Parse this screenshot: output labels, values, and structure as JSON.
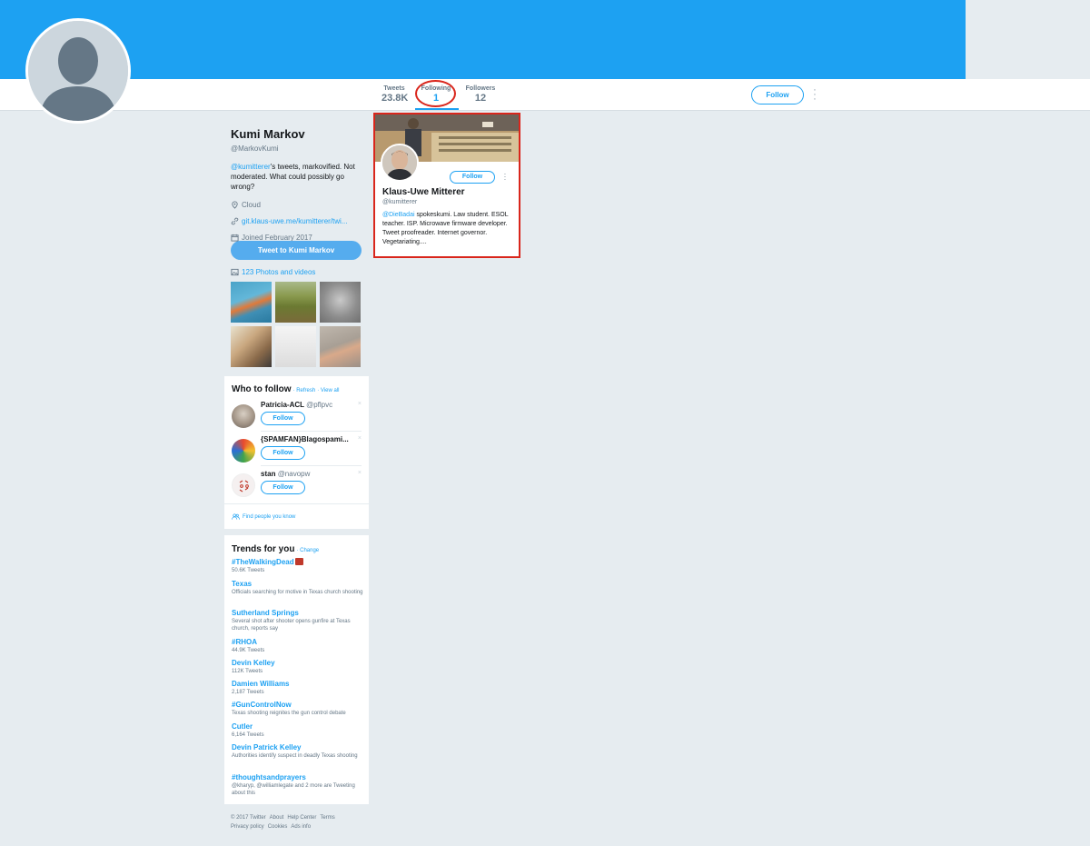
{
  "profile": {
    "name": "Kumi Markov",
    "handle": "@MarkovKumi",
    "bio_mention": "@kumitterer",
    "bio_text": "'s tweets, markovified. Not moderated. What could possibly go wrong?",
    "location": "Cloud",
    "website": "git.klaus-uwe.me/kumitterer/twi...",
    "joined": "Joined February 2017",
    "tweet_to_label": "Tweet to Kumi Markov",
    "photos_label": "123 Photos and videos"
  },
  "stats": [
    {
      "label": "Tweets",
      "value": "23.8K"
    },
    {
      "label": "Following",
      "value": "1"
    },
    {
      "label": "Followers",
      "value": "12"
    }
  ],
  "header": {
    "follow_label": "Follow"
  },
  "following_card": {
    "name": "Klaus-Uwe Mitterer",
    "handle": "@kumitterer",
    "follow_label": "Follow",
    "bio_mention": "@DieBadai",
    "bio_text": " spokeskumi. Law student. ESOL teacher. ISP. Microwave firmware developer. Tweet proofreader. Internet governor. Vegetariating...."
  },
  "who_to_follow": {
    "title": "Who to follow",
    "refresh": "· Refresh",
    "view_all": "· View all",
    "items": [
      {
        "name": "Patricia-ACL",
        "handle": "@pflpvc",
        "follow_label": "Follow"
      },
      {
        "name": "{SPAMFAN}Blagospami...",
        "handle": "",
        "follow_label": "Follow"
      },
      {
        "name": "stan",
        "handle": "@navopw",
        "follow_label": "Follow"
      }
    ],
    "close_glyph": "×",
    "find_people": "Find people you know"
  },
  "trends": {
    "title": "Trends for you",
    "change": "· Change",
    "items": [
      {
        "name": "#TheWalkingDead",
        "desc": "50.6K Tweets"
      },
      {
        "name": "Texas",
        "desc": "Officials searching for motive in Texas church shooting"
      },
      {
        "name": "Sutherland Springs",
        "desc": "Several shot after shooter opens gunfire at Texas church, reports say"
      },
      {
        "name": "#RHOA",
        "desc": "44.9K Tweets"
      },
      {
        "name": "Devin Kelley",
        "desc": "112K Tweets"
      },
      {
        "name": "Damien Williams",
        "desc": "2,187 Tweets"
      },
      {
        "name": "#GunControlNow",
        "desc": "Texas shooting reignites the gun control debate"
      },
      {
        "name": "Cutler",
        "desc": "6,164 Tweets"
      },
      {
        "name": "Devin Patrick Kelley",
        "desc": "Authorities identify suspect in deadly Texas shooting"
      },
      {
        "name": "#thoughtsandprayers",
        "desc": "@kharyp, @williamlegate and 2 more are Tweeting about this"
      }
    ]
  },
  "footer": {
    "links": [
      "© 2017 Twitter",
      "About",
      "Help Center",
      "Terms",
      "Privacy policy",
      "Cookies",
      "Ads info"
    ]
  },
  "colors": {
    "brand": "#1da1f2",
    "highlight": "#d9261c",
    "background": "#e6ecf0"
  }
}
